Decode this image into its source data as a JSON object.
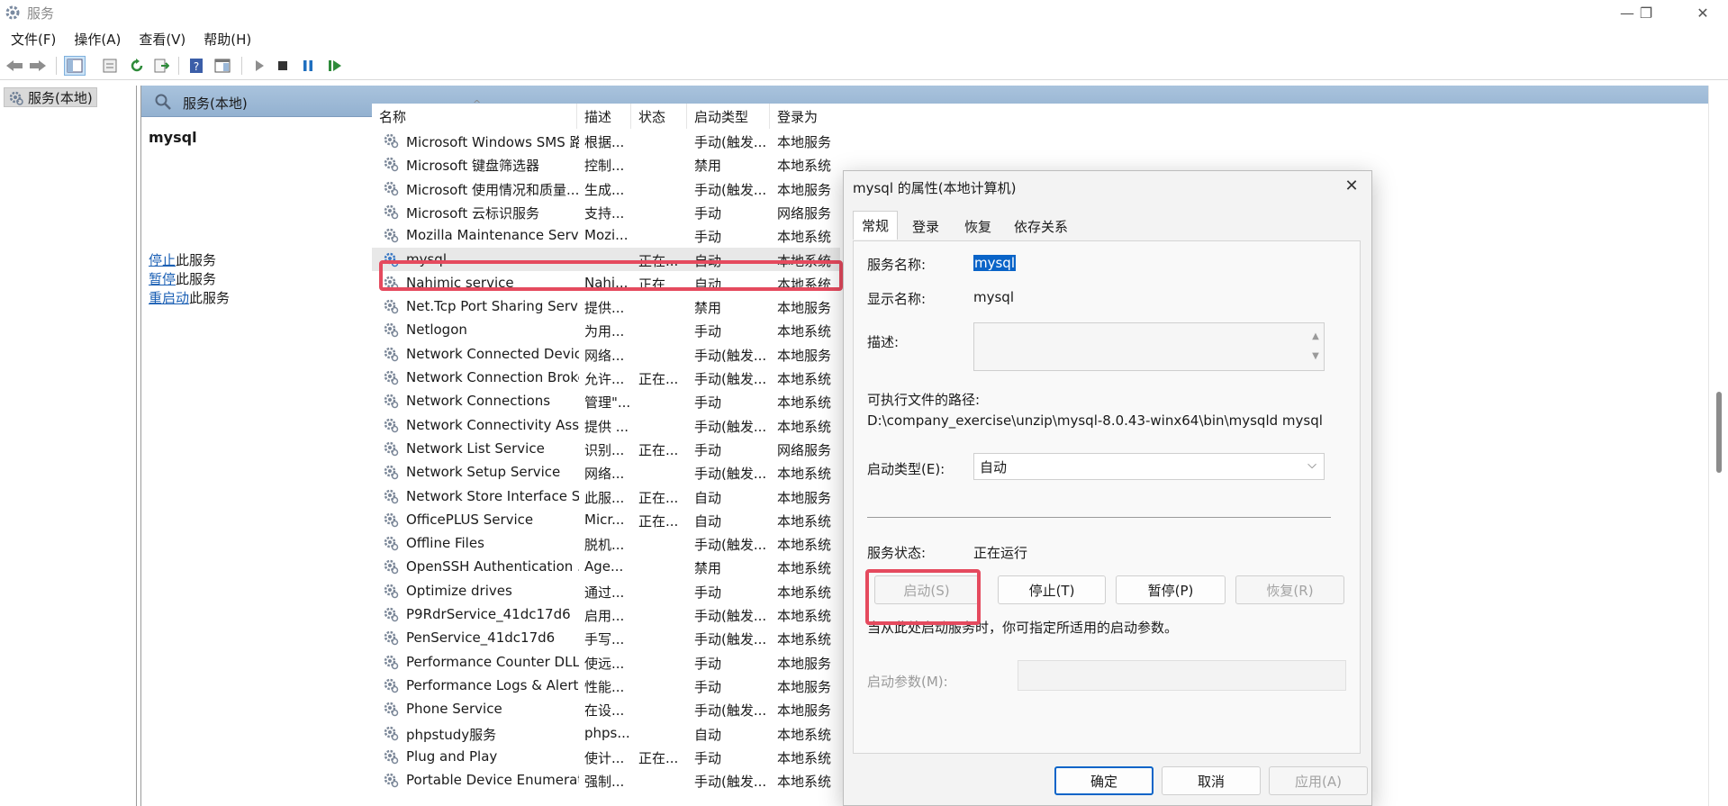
{
  "window": {
    "title": "服务",
    "minimize": "—",
    "restore": "❐",
    "close": "✕"
  },
  "menu": [
    "文件(F)",
    "操作(A)",
    "查看(V)",
    "帮助(H)"
  ],
  "tree": {
    "root_label": "服务(本地)"
  },
  "pane_header": {
    "label": "服务(本地)"
  },
  "detail": {
    "service_name": "mysql",
    "actions": [
      {
        "link": "停止",
        "rest": "此服务"
      },
      {
        "link": "暂停",
        "rest": "此服务"
      },
      {
        "link": "重启动",
        "rest": "此服务"
      }
    ]
  },
  "columns": [
    "名称",
    "描述",
    "状态",
    "启动类型",
    "登录为"
  ],
  "sort_indicator": "^",
  "services": [
    {
      "name": "Microsoft Windows SMS 路...",
      "desc": "根据...",
      "status": "",
      "startup": "手动(触发...",
      "logon": "本地服务"
    },
    {
      "name": "Microsoft 键盘筛选器",
      "desc": "控制...",
      "status": "",
      "startup": "禁用",
      "logon": "本地系统"
    },
    {
      "name": "Microsoft 使用情况和质量...",
      "desc": "生成...",
      "status": "",
      "startup": "手动(触发...",
      "logon": "本地服务"
    },
    {
      "name": "Microsoft 云标识服务",
      "desc": "支持...",
      "status": "",
      "startup": "手动",
      "logon": "网络服务"
    },
    {
      "name": "Mozilla Maintenance Service",
      "desc": "Mozi...",
      "status": "",
      "startup": "手动",
      "logon": "本地系统"
    },
    {
      "name": "mysql",
      "desc": "",
      "status": "正在...",
      "startup": "自动",
      "logon": "本地系统"
    },
    {
      "name": "Nahimic service",
      "desc": "Nahi...",
      "status": "正在...",
      "startup": "自动",
      "logon": "本地系统"
    },
    {
      "name": "Net.Tcp Port Sharing Service",
      "desc": "提供...",
      "status": "",
      "startup": "禁用",
      "logon": "本地服务"
    },
    {
      "name": "Netlogon",
      "desc": "为用...",
      "status": "",
      "startup": "手动",
      "logon": "本地系统"
    },
    {
      "name": "Network Connected Devic...",
      "desc": "网络...",
      "status": "",
      "startup": "手动(触发...",
      "logon": "本地服务"
    },
    {
      "name": "Network Connection Broker",
      "desc": "允许...",
      "status": "正在...",
      "startup": "手动(触发...",
      "logon": "本地系统"
    },
    {
      "name": "Network Connections",
      "desc": "管理\"...",
      "status": "",
      "startup": "手动",
      "logon": "本地系统"
    },
    {
      "name": "Network Connectivity Assis...",
      "desc": "提供 ...",
      "status": "",
      "startup": "手动(触发...",
      "logon": "本地系统"
    },
    {
      "name": "Network List Service",
      "desc": "识别...",
      "status": "正在...",
      "startup": "手动",
      "logon": "网络服务"
    },
    {
      "name": "Network Setup Service",
      "desc": "网络...",
      "status": "",
      "startup": "手动(触发...",
      "logon": "本地系统"
    },
    {
      "name": "Network Store Interface Se...",
      "desc": "此服...",
      "status": "正在...",
      "startup": "自动",
      "logon": "本地服务"
    },
    {
      "name": "OfficePLUS Service",
      "desc": "Micr...",
      "status": "正在...",
      "startup": "自动",
      "logon": "本地系统"
    },
    {
      "name": "Offline Files",
      "desc": "脱机...",
      "status": "",
      "startup": "手动(触发...",
      "logon": "本地系统"
    },
    {
      "name": "OpenSSH Authentication ...",
      "desc": "Age...",
      "status": "",
      "startup": "禁用",
      "logon": "本地系统"
    },
    {
      "name": "Optimize drives",
      "desc": "通过...",
      "status": "",
      "startup": "手动",
      "logon": "本地系统"
    },
    {
      "name": "P9RdrService_41dc17d6",
      "desc": "启用...",
      "status": "",
      "startup": "手动(触发...",
      "logon": "本地系统"
    },
    {
      "name": "PenService_41dc17d6",
      "desc": "手写...",
      "status": "",
      "startup": "手动(触发...",
      "logon": "本地系统"
    },
    {
      "name": "Performance Counter DLL ...",
      "desc": "使远...",
      "status": "",
      "startup": "手动",
      "logon": "本地服务"
    },
    {
      "name": "Performance Logs & Alerts",
      "desc": "性能...",
      "status": "",
      "startup": "手动",
      "logon": "本地服务"
    },
    {
      "name": "Phone Service",
      "desc": "在设...",
      "status": "",
      "startup": "手动(触发...",
      "logon": "本地服务"
    },
    {
      "name": "phpstudy服务",
      "desc": "phps...",
      "status": "",
      "startup": "自动",
      "logon": "本地系统"
    },
    {
      "name": "Plug and Play",
      "desc": "使计...",
      "status": "正在...",
      "startup": "手动",
      "logon": "本地系统"
    },
    {
      "name": "Portable Device Enumerat...",
      "desc": "强制...",
      "status": "",
      "startup": "手动(触发...",
      "logon": "本地系统"
    }
  ],
  "selected_service": "mysql",
  "dialog": {
    "title": "mysql 的属性(本地计算机)",
    "close": "✕",
    "tabs": [
      "常规",
      "登录",
      "恢复",
      "依存关系"
    ],
    "active_tab": "常规",
    "service_name_label": "服务名称:",
    "service_name_value": "mysql",
    "display_name_label": "显示名称:",
    "display_name_value": "mysql",
    "description_label": "描述:",
    "path_label": "可执行文件的路径:",
    "path_value": "D:\\company_exercise\\unzip\\mysql-8.0.43-winx64\\bin\\mysqld mysql",
    "startup_type_label": "启动类型(E):",
    "startup_type_value": "自动",
    "status_label": "服务状态:",
    "status_value": "正在运行",
    "buttons": {
      "start": "启动(S)",
      "stop": "停止(T)",
      "pause": "暂停(P)",
      "resume": "恢复(R)"
    },
    "hint": "当从此处启动服务时，你可指定所适用的启动参数。",
    "params_label": "启动参数(M):",
    "footer": {
      "ok": "确定",
      "cancel": "取消",
      "apply": "应用(A)"
    }
  },
  "colors": {
    "highlight": "#e54a5e",
    "selection": "#0a64c8",
    "link": "#1a5fb4",
    "header": "#a9c3dd"
  }
}
